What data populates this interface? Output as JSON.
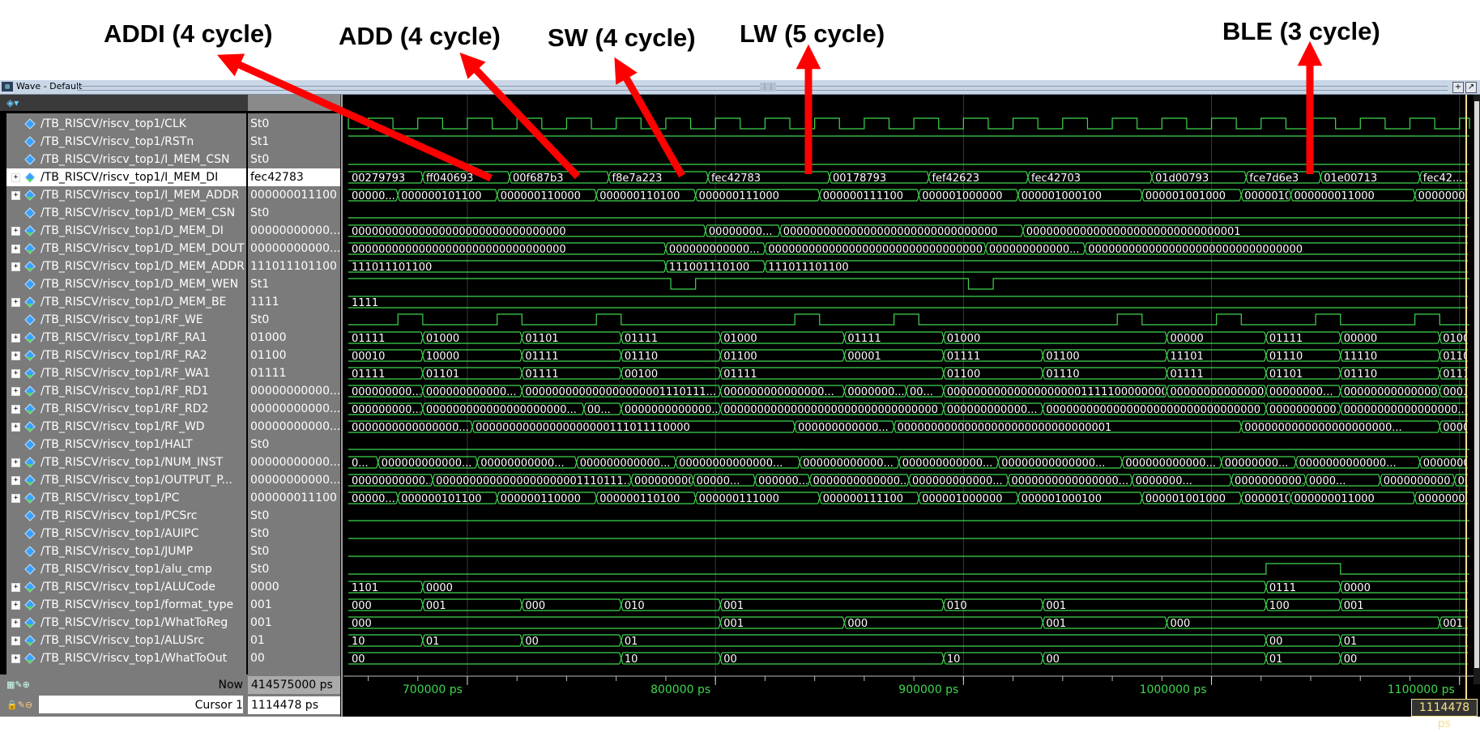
{
  "annotations": [
    {
      "label": "ADDI (4 cycle)"
    },
    {
      "label": "ADD (4 cycle)"
    },
    {
      "label": "SW (4 cycle)"
    },
    {
      "label": "LW (5 cycle)"
    },
    {
      "label": "BLE (3 cycle)"
    }
  ],
  "window": {
    "title": "Wave - Default"
  },
  "signals": [
    {
      "name": "/TB_RISCV/riscv_top1/CLK",
      "value": "St0",
      "bus": false
    },
    {
      "name": "/TB_RISCV/riscv_top1/RSTn",
      "value": "St1",
      "bus": false
    },
    {
      "name": "/TB_RISCV/riscv_top1/I_MEM_CSN",
      "value": "St0",
      "bus": false
    },
    {
      "name": "/TB_RISCV/riscv_top1/I_MEM_DI",
      "value": "fec42783",
      "bus": true,
      "selected": true
    },
    {
      "name": "/TB_RISCV/riscv_top1/I_MEM_ADDR",
      "value": "000000011100",
      "bus": true
    },
    {
      "name": "/TB_RISCV/riscv_top1/D_MEM_CSN",
      "value": "St0",
      "bus": false
    },
    {
      "name": "/TB_RISCV/riscv_top1/D_MEM_DI",
      "value": "00000000000...",
      "bus": true
    },
    {
      "name": "/TB_RISCV/riscv_top1/D_MEM_DOUT",
      "value": "00000000000...",
      "bus": true
    },
    {
      "name": "/TB_RISCV/riscv_top1/D_MEM_ADDR",
      "value": "111011101100",
      "bus": true
    },
    {
      "name": "/TB_RISCV/riscv_top1/D_MEM_WEN",
      "value": "St1",
      "bus": false
    },
    {
      "name": "/TB_RISCV/riscv_top1/D_MEM_BE",
      "value": "1111",
      "bus": true
    },
    {
      "name": "/TB_RISCV/riscv_top1/RF_WE",
      "value": "St0",
      "bus": false
    },
    {
      "name": "/TB_RISCV/riscv_top1/RF_RA1",
      "value": "01000",
      "bus": true
    },
    {
      "name": "/TB_RISCV/riscv_top1/RF_RA2",
      "value": "01100",
      "bus": true
    },
    {
      "name": "/TB_RISCV/riscv_top1/RF_WA1",
      "value": "01111",
      "bus": true
    },
    {
      "name": "/TB_RISCV/riscv_top1/RF_RD1",
      "value": "00000000000...",
      "bus": true
    },
    {
      "name": "/TB_RISCV/riscv_top1/RF_RD2",
      "value": "00000000000...",
      "bus": true
    },
    {
      "name": "/TB_RISCV/riscv_top1/RF_WD",
      "value": "00000000000...",
      "bus": true
    },
    {
      "name": "/TB_RISCV/riscv_top1/HALT",
      "value": "St0",
      "bus": false
    },
    {
      "name": "/TB_RISCV/riscv_top1/NUM_INST",
      "value": "00000000000...",
      "bus": true
    },
    {
      "name": "/TB_RISCV/riscv_top1/OUTPUT_P...",
      "value": "00000000000...",
      "bus": true
    },
    {
      "name": "/TB_RISCV/riscv_top1/PC",
      "value": "000000011100",
      "bus": true
    },
    {
      "name": "/TB_RISCV/riscv_top1/PCSrc",
      "value": "St0",
      "bus": false
    },
    {
      "name": "/TB_RISCV/riscv_top1/AUIPC",
      "value": "St0",
      "bus": false
    },
    {
      "name": "/TB_RISCV/riscv_top1/JUMP",
      "value": "St0",
      "bus": false
    },
    {
      "name": "/TB_RISCV/riscv_top1/alu_cmp",
      "value": "St0",
      "bus": false
    },
    {
      "name": "/TB_RISCV/riscv_top1/ALUCode",
      "value": "0000",
      "bus": true
    },
    {
      "name": "/TB_RISCV/riscv_top1/format_type",
      "value": "001",
      "bus": true
    },
    {
      "name": "/TB_RISCV/riscv_top1/WhatToReg",
      "value": "001",
      "bus": true
    },
    {
      "name": "/TB_RISCV/riscv_top1/ALUSrc",
      "value": "01",
      "bus": true
    },
    {
      "name": "/TB_RISCV/riscv_top1/WhatToOut",
      "value": "00",
      "bus": true
    }
  ],
  "waves": {
    "clock_period_ps": 20000,
    "view_start_ps": 652000,
    "view_end_ps": 1104000,
    "bus": [
      {
        "row": 3,
        "segments": [
          [
            652000,
            "00279793"
          ],
          [
            682000,
            "ff040693"
          ],
          [
            717000,
            "00f687b3"
          ],
          [
            757000,
            "f8e7a223"
          ],
          [
            797000,
            "fec42783"
          ],
          [
            846000,
            "00178793"
          ],
          [
            886000,
            "fef42623"
          ],
          [
            926000,
            "fec42703"
          ],
          [
            976000,
            "01d00793"
          ],
          [
            1014000,
            "fce7d6e3"
          ],
          [
            1044000,
            "01e00713"
          ],
          [
            1084000,
            "fec42..."
          ]
        ]
      },
      {
        "row": 4,
        "segments": [
          [
            652000,
            "00000..."
          ],
          [
            672000,
            "000000101100"
          ],
          [
            712000,
            "000000110000"
          ],
          [
            752000,
            "000000110100"
          ],
          [
            792000,
            "000000111000"
          ],
          [
            842000,
            "000000111100"
          ],
          [
            882000,
            "000001000000"
          ],
          [
            922000,
            "000001000100"
          ],
          [
            972000,
            "000001001000"
          ],
          [
            1012000,
            "00000100..."
          ],
          [
            1032000,
            "000000011000"
          ],
          [
            1082000,
            "0000000..."
          ]
        ]
      },
      {
        "row": 6,
        "segments": [
          [
            652000,
            "00000000000000000000000000000000"
          ],
          [
            796000,
            "00000000..."
          ],
          [
            826000,
            "00000000000000000000000000000000"
          ],
          [
            924000,
            "00000000000000000000000000000001"
          ]
        ]
      },
      {
        "row": 7,
        "segments": [
          [
            652000,
            "00000000000000000000000000000000"
          ],
          [
            780000,
            "000000000000..."
          ],
          [
            820000,
            "00000000000000000000000000000000"
          ],
          [
            909000,
            "000000000000..."
          ],
          [
            949000,
            "00000000000000000000000000000000"
          ]
        ]
      },
      {
        "row": 8,
        "segments": [
          [
            652000,
            "111011101100"
          ],
          [
            780000,
            "111001110100"
          ],
          [
            820000,
            "111011101100"
          ]
        ]
      },
      {
        "row": 10,
        "segments": [
          [
            652000,
            "1111"
          ]
        ]
      },
      {
        "row": 12,
        "segments": [
          [
            652000,
            "01111"
          ],
          [
            682000,
            "01000"
          ],
          [
            722000,
            "01101"
          ],
          [
            762000,
            "01111"
          ],
          [
            802000,
            "01000"
          ],
          [
            852000,
            "01111"
          ],
          [
            892000,
            "01000"
          ],
          [
            982000,
            "00000"
          ],
          [
            1022000,
            "01111"
          ],
          [
            1052000,
            "00000"
          ],
          [
            1092000,
            "01000"
          ]
        ]
      },
      {
        "row": 13,
        "segments": [
          [
            652000,
            "00010"
          ],
          [
            682000,
            "10000"
          ],
          [
            722000,
            "01111"
          ],
          [
            762000,
            "01110"
          ],
          [
            802000,
            "01100"
          ],
          [
            852000,
            "00001"
          ],
          [
            892000,
            "01111"
          ],
          [
            932000,
            "01100"
          ],
          [
            982000,
            "11101"
          ],
          [
            1022000,
            "01110"
          ],
          [
            1052000,
            "11110"
          ],
          [
            1092000,
            "01100"
          ]
        ]
      },
      {
        "row": 14,
        "segments": [
          [
            652000,
            "01111"
          ],
          [
            682000,
            "01101"
          ],
          [
            722000,
            "01111"
          ],
          [
            762000,
            "00100"
          ],
          [
            802000,
            "01111"
          ],
          [
            892000,
            "01100"
          ],
          [
            932000,
            "01110"
          ],
          [
            982000,
            "01111"
          ],
          [
            1022000,
            "01101"
          ],
          [
            1052000,
            "01110"
          ],
          [
            1092000,
            "01111"
          ]
        ]
      },
      {
        "row": 15,
        "segments": [
          [
            652000,
            "000000000..."
          ],
          [
            682000,
            "000000000000..."
          ],
          [
            722000,
            "000000000000000000001110111..."
          ],
          [
            802000,
            "000000000000000..."
          ],
          [
            852000,
            "0000000..."
          ],
          [
            877000,
            "00..."
          ],
          [
            892000,
            "000000000000000000001111100000000"
          ],
          [
            982000,
            "00000000000000000..."
          ],
          [
            1022000,
            "00000000..."
          ],
          [
            1052000,
            "0000000000000000..."
          ],
          [
            1092000,
            "000..."
          ]
        ]
      },
      {
        "row": 16,
        "segments": [
          [
            652000,
            "000000000..."
          ],
          [
            682000,
            "000000000000000000000..."
          ],
          [
            747000,
            "00..."
          ],
          [
            762000,
            "0000000000000..."
          ],
          [
            802000,
            "00000000000000000000000000000000"
          ],
          [
            892000,
            "000000000000..."
          ],
          [
            932000,
            "00000000000000000000000000000000"
          ],
          [
            1022000,
            "0000000000..."
          ],
          [
            1052000,
            "00000000000000000..."
          ]
        ]
      },
      {
        "row": 17,
        "segments": [
          [
            652000,
            "0000000000000000..."
          ],
          [
            702000,
            "00000000000000000000111011110000"
          ],
          [
            832000,
            "000000000000..."
          ],
          [
            872000,
            "00000000000000000000000000000001"
          ],
          [
            1012000,
            "0000000000000000000000..."
          ],
          [
            1092000,
            "0000000000..."
          ]
        ]
      },
      {
        "row": 19,
        "segments": [
          [
            652000,
            "0..."
          ],
          [
            664000,
            "000000000000..."
          ],
          [
            704000,
            "00000000000..."
          ],
          [
            744000,
            "000000000000..."
          ],
          [
            784000,
            "00000000000000..."
          ],
          [
            834000,
            "000000000000..."
          ],
          [
            874000,
            "000000000000..."
          ],
          [
            914000,
            "00000000000000..."
          ],
          [
            964000,
            "000000000000..."
          ],
          [
            1004000,
            "00000000..."
          ],
          [
            1034000,
            "0000000000000..."
          ],
          [
            1084000,
            "000000000000..."
          ]
        ]
      },
      {
        "row": 20,
        "segments": [
          [
            652000,
            "00000000000..."
          ],
          [
            686000,
            "0000000000000000000001110111..."
          ],
          [
            766000,
            "0000000000..."
          ],
          [
            791000,
            "00000..."
          ],
          [
            816000,
            "000000..."
          ],
          [
            838000,
            "0000000000000..."
          ],
          [
            878000,
            "000000000000..."
          ],
          [
            918000,
            "0000000000000000..."
          ],
          [
            968000,
            "0000000..."
          ],
          [
            1008000,
            "0000000000..."
          ],
          [
            1038000,
            "0000..."
          ],
          [
            1068000,
            "0000000000..."
          ],
          [
            1098000,
            "000..."
          ]
        ]
      },
      {
        "row": 21,
        "segments": [
          [
            652000,
            "00000..."
          ],
          [
            672000,
            "000000101100"
          ],
          [
            712000,
            "000000110000"
          ],
          [
            752000,
            "000000110100"
          ],
          [
            792000,
            "000000111000"
          ],
          [
            842000,
            "000000111100"
          ],
          [
            882000,
            "000001000000"
          ],
          [
            922000,
            "000001000100"
          ],
          [
            972000,
            "000001001000"
          ],
          [
            1012000,
            "00000100..."
          ],
          [
            1032000,
            "000000011000"
          ],
          [
            1082000,
            "0000000..."
          ]
        ]
      },
      {
        "row": 26,
        "segments": [
          [
            652000,
            "1101"
          ],
          [
            682000,
            "0000"
          ],
          [
            1022000,
            "0111"
          ],
          [
            1052000,
            "0000"
          ]
        ]
      },
      {
        "row": 27,
        "segments": [
          [
            652000,
            "000"
          ],
          [
            682000,
            "001"
          ],
          [
            722000,
            "000"
          ],
          [
            762000,
            "010"
          ],
          [
            802000,
            "001"
          ],
          [
            892000,
            "010"
          ],
          [
            932000,
            "001"
          ],
          [
            1022000,
            "100"
          ],
          [
            1052000,
            "001"
          ]
        ]
      },
      {
        "row": 28,
        "segments": [
          [
            652000,
            "000"
          ],
          [
            802000,
            "001"
          ],
          [
            852000,
            "000"
          ],
          [
            932000,
            "001"
          ],
          [
            982000,
            "000"
          ],
          [
            1092000,
            "001"
          ]
        ]
      },
      {
        "row": 29,
        "segments": [
          [
            652000,
            "10"
          ],
          [
            682000,
            "01"
          ],
          [
            722000,
            "00"
          ],
          [
            762000,
            "01"
          ],
          [
            1022000,
            "00"
          ],
          [
            1052000,
            "01"
          ]
        ]
      },
      {
        "row": 30,
        "segments": [
          [
            652000,
            "00"
          ],
          [
            762000,
            "10"
          ],
          [
            802000,
            "00"
          ],
          [
            892000,
            "10"
          ],
          [
            932000,
            "00"
          ],
          [
            1022000,
            "01"
          ],
          [
            1052000,
            "00"
          ]
        ]
      }
    ],
    "bits": [
      {
        "row": 1,
        "init": 1,
        "edges": []
      },
      {
        "row": 2,
        "init": 0,
        "edges": []
      },
      {
        "row": 5,
        "init": 0,
        "edges": []
      },
      {
        "row": 9,
        "init": 1,
        "edges": [
          782000,
          792000,
          902000,
          912000
        ]
      },
      {
        "row": 11,
        "init": 0,
        "edges": [
          672000,
          682000,
          712000,
          722000,
          752000,
          762000,
          832000,
          842000,
          872000,
          882000,
          962000,
          972000,
          1002000,
          1012000,
          1042000,
          1052000,
          1082000,
          1092000
        ]
      },
      {
        "row": 18,
        "init": 0,
        "edges": []
      },
      {
        "row": 22,
        "init": 0,
        "edges": []
      },
      {
        "row": 23,
        "init": 0,
        "edges": []
      },
      {
        "row": 24,
        "init": 0,
        "edges": []
      },
      {
        "row": 25,
        "init": 0,
        "edges": [
          1022000,
          1052000
        ]
      }
    ]
  },
  "status": {
    "now_label": "Now",
    "now_value": "414575000 ps",
    "cursor_label": "Cursor 1",
    "cursor_value": "1114478 ps",
    "cursor_readout": "1114478 ps"
  },
  "timeline": {
    "ticks": [
      {
        "t": 700000,
        "label": "700000 ps"
      },
      {
        "t": 800000,
        "label": "800000 ps"
      },
      {
        "t": 900000,
        "label": "900000 ps"
      },
      {
        "t": 1000000,
        "label": "1000000 ps"
      },
      {
        "t": 1100000,
        "label": "1100000 ps"
      }
    ]
  },
  "colors": {
    "wave": "#3fd64f",
    "bus_text": "#ffffff",
    "tick_text": "#3fd64f",
    "cursor": "#f5e08a",
    "arrow": "#ff0000"
  }
}
